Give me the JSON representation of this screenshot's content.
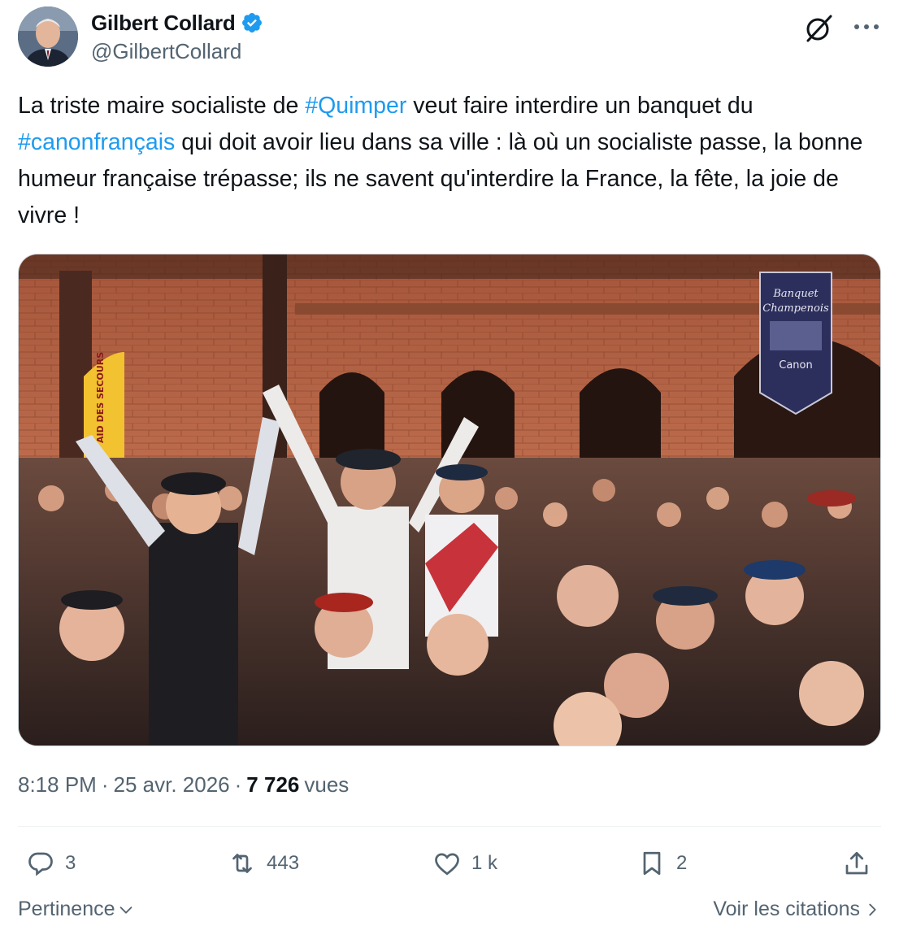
{
  "author": {
    "display_name": "Gilbert Collard",
    "handle": "@GilbertCollard",
    "verified": true,
    "avatar_icon": "profile-photo"
  },
  "tweet": {
    "segments": [
      {
        "text": "La triste maire socialiste de ",
        "type": "text"
      },
      {
        "text": "#Quimper",
        "type": "hashtag"
      },
      {
        "text": " veut faire interdire un banquet du ",
        "type": "text"
      },
      {
        "text": "#canonfrançais",
        "type": "hashtag"
      },
      {
        "text": " qui doit avoir lieu dans sa ville : là où un socialiste passe, la bonne humeur française trépasse; ils ne savent qu'interdire la France, la fête, la joie de vivre !",
        "type": "text"
      }
    ]
  },
  "media": {
    "banner_line1": "Banquet",
    "banner_line2": "Champenois",
    "banner_logo": "Canon",
    "flag_text": "AID DES SECOURS"
  },
  "meta": {
    "time": "8:18 PM",
    "separator": "·",
    "date": "25 avr. 2026",
    "views_count": "7 726",
    "views_label": "vues"
  },
  "actions": {
    "replies": "3",
    "reposts": "443",
    "likes": "1 k",
    "bookmarks": "2"
  },
  "footer": {
    "sort_label": "Pertinence",
    "quotes_label": "Voir les citations"
  },
  "colors": {
    "accent": "#1d9bf0",
    "secondary_text": "#536471",
    "primary_text": "#0f1419"
  },
  "icons": {
    "verified": "verified-badge-icon",
    "grok": "grok-icon",
    "more": "more-icon",
    "reply": "reply-icon",
    "repost": "repost-icon",
    "like": "heart-icon",
    "bookmark": "bookmark-icon",
    "share": "share-icon",
    "chevron_down": "chevron-down-icon",
    "chevron_right": "chevron-right-icon"
  }
}
